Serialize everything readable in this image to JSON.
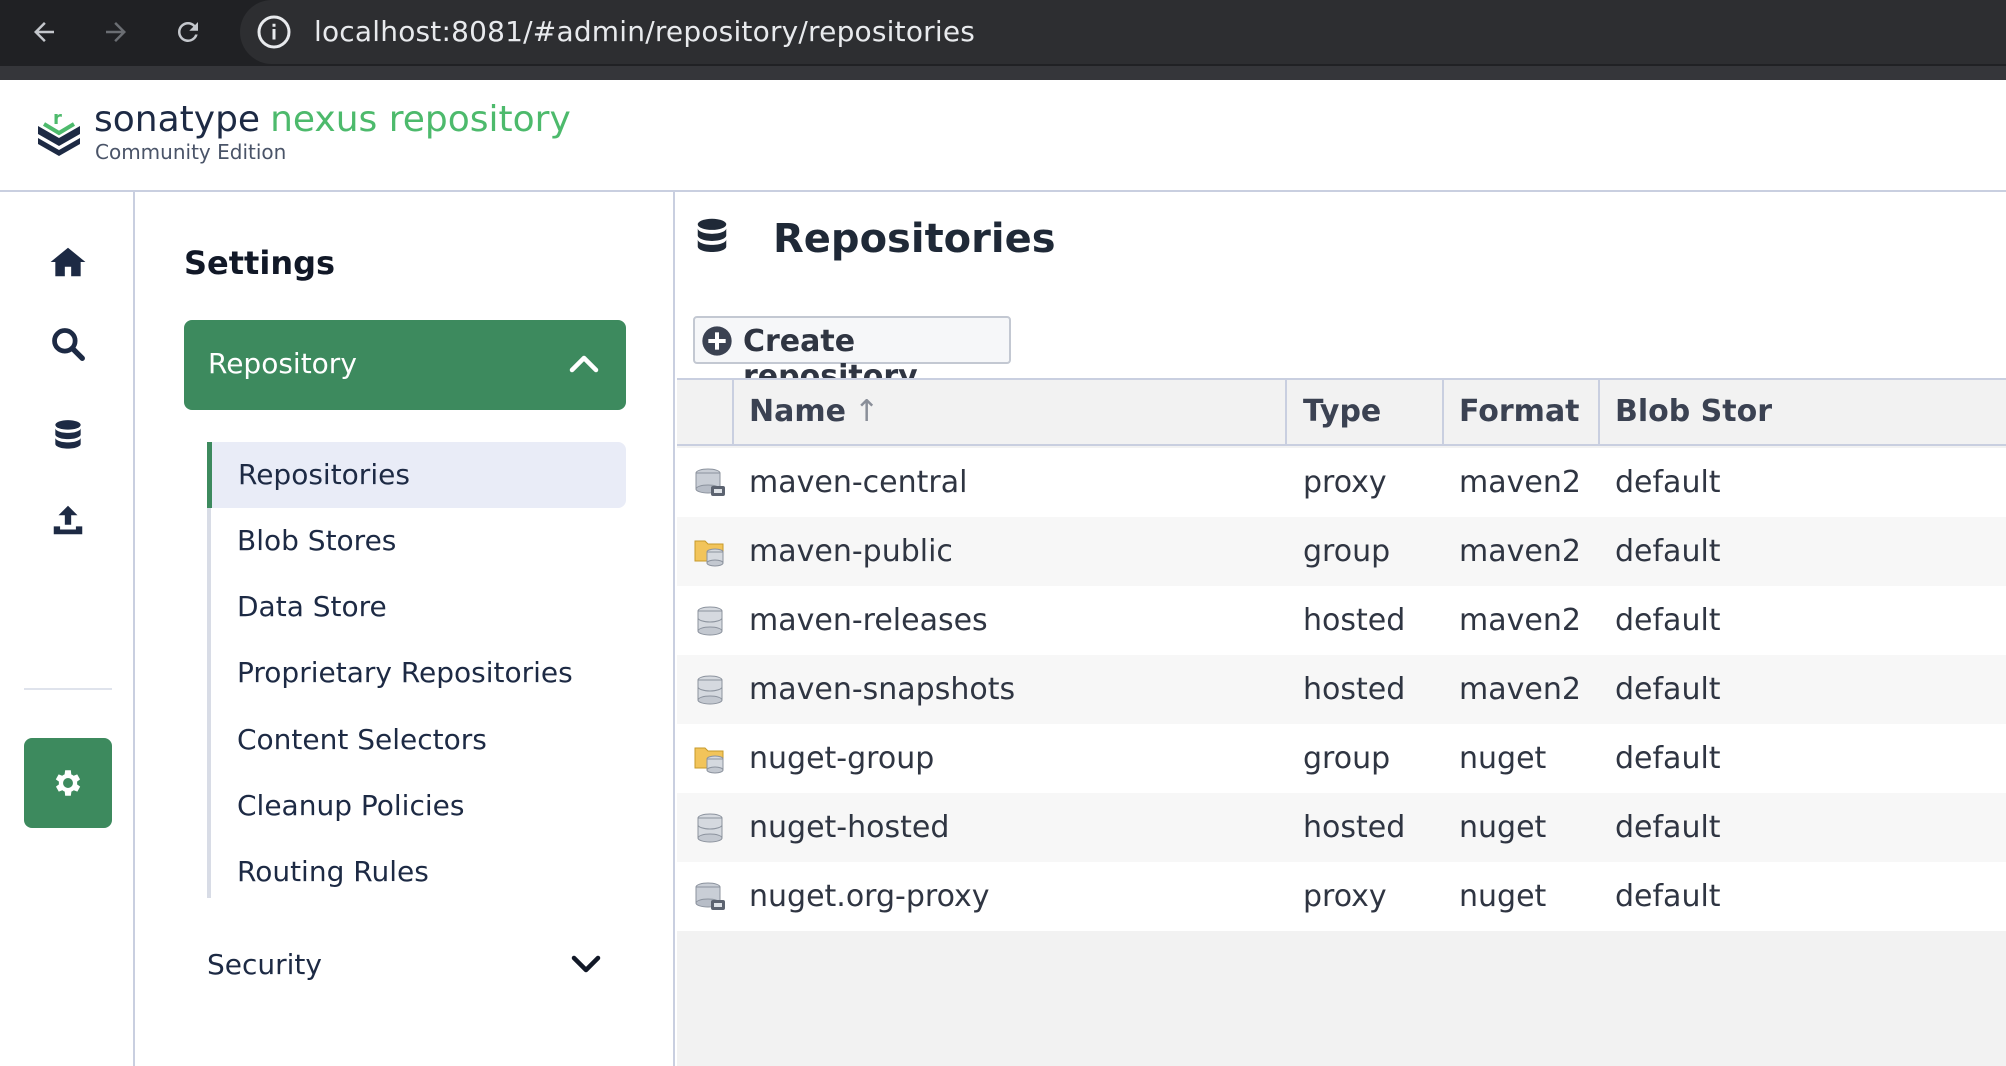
{
  "browser": {
    "url": "localhost:8081/#admin/repository/repositories"
  },
  "header": {
    "brand_primary": "sonatype",
    "brand_secondary": "nexus repository",
    "edition": "Community Edition",
    "brand_color": "#4dba6c"
  },
  "rail": {
    "items": [
      {
        "name": "home-icon"
      },
      {
        "name": "search-icon"
      },
      {
        "name": "database-icon"
      },
      {
        "name": "upload-icon"
      },
      {
        "name": "gear-icon",
        "active": true
      }
    ],
    "active_color": "#3d8a5e"
  },
  "settings": {
    "title": "Settings",
    "repository_group": "Repository",
    "items": [
      {
        "label": "Repositories",
        "active": true
      },
      {
        "label": "Blob Stores"
      },
      {
        "label": "Data Store"
      },
      {
        "label": "Proprietary Repositories"
      },
      {
        "label": "Content Selectors"
      },
      {
        "label": "Cleanup Policies"
      },
      {
        "label": "Routing Rules"
      }
    ],
    "security_group": "Security"
  },
  "main": {
    "title": "Repositories",
    "create_button": "Create repository",
    "columns": {
      "name": "Name",
      "type": "Type",
      "format": "Format",
      "blob": "Blob Stor"
    },
    "rows": [
      {
        "icon": "proxy-repo-icon",
        "name": "maven-central",
        "type": "proxy",
        "format": "maven2",
        "blob": "default"
      },
      {
        "icon": "group-repo-icon",
        "name": "maven-public",
        "type": "group",
        "format": "maven2",
        "blob": "default"
      },
      {
        "icon": "hosted-repo-icon",
        "name": "maven-releases",
        "type": "hosted",
        "format": "maven2",
        "blob": "default"
      },
      {
        "icon": "hosted-repo-icon",
        "name": "maven-snapshots",
        "type": "hosted",
        "format": "maven2",
        "blob": "default"
      },
      {
        "icon": "group-repo-icon",
        "name": "nuget-group",
        "type": "group",
        "format": "nuget",
        "blob": "default"
      },
      {
        "icon": "hosted-repo-icon",
        "name": "nuget-hosted",
        "type": "hosted",
        "format": "nuget",
        "blob": "default"
      },
      {
        "icon": "proxy-repo-icon",
        "name": "nuget.org-proxy",
        "type": "proxy",
        "format": "nuget",
        "blob": "default"
      }
    ]
  }
}
